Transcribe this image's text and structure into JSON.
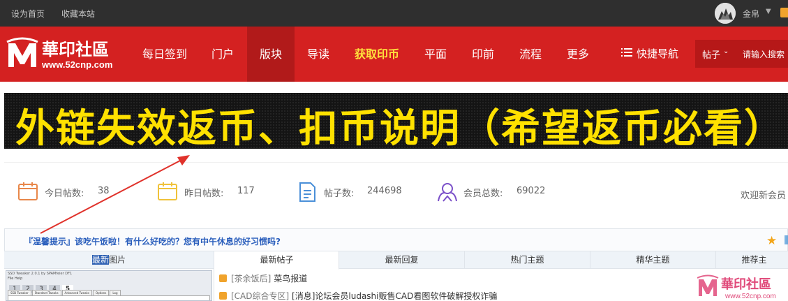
{
  "topbar": {
    "set_home": "设为首页",
    "bookmark": "收藏本站",
    "username": "金帛"
  },
  "nav": {
    "logo_cn": "華印社區",
    "logo_url": "www.52cnp.com",
    "items": [
      {
        "label": "每日签到"
      },
      {
        "label": "门户"
      },
      {
        "label": "版块"
      },
      {
        "label": "导读"
      },
      {
        "label": "获取印币"
      },
      {
        "label": "平面"
      },
      {
        "label": "印前"
      },
      {
        "label": "流程"
      },
      {
        "label": "更多"
      }
    ],
    "active_index": 2,
    "highlight_index": 4,
    "quick_nav": "快捷导航",
    "search_type": "帖子",
    "search_placeholder": "请输入搜索"
  },
  "banner": {
    "text": "外链失效返币、扣币说明（希望返币必看）"
  },
  "stats": {
    "today_label": "今日帖数:",
    "today_value": "38",
    "yesterday_label": "昨日帖数:",
    "yesterday_value": "117",
    "posts_label": "帖子数:",
    "posts_value": "244698",
    "members_label": "会员总数:",
    "members_value": "69022",
    "welcome": "欢迎新会员"
  },
  "notice": {
    "text": "『温馨提示』该吃午饭啦！有什么好吃的？您有中午休息的好习惯吗?"
  },
  "left_panel": {
    "title_sel": "最新",
    "title_rest": "图片",
    "thumb_title": "SSD Tweaker 2.0.1 by SPAMfeier DF1",
    "thumb_menu": "File   Help",
    "thumb_numbers": [
      "1",
      "2",
      "3",
      "4",
      "5"
    ],
    "thumb_tabs": [
      "SSD Tweaker",
      "Standard Tweaks",
      "Advanced Tweaks",
      "Options",
      "Log"
    ]
  },
  "tabs": [
    {
      "label": "最新帖子"
    },
    {
      "label": "最新回复"
    },
    {
      "label": "热门主题"
    },
    {
      "label": "精华主题"
    },
    {
      "label": "推荐主"
    }
  ],
  "posts": [
    {
      "category": "[茶余饭后]",
      "title": "菜鸟报道"
    },
    {
      "category": "[CAD综合专区]",
      "title": "[消息]论坛会员ludashi贩售CAD看图软件破解授权诈骗"
    }
  ],
  "watermark": {
    "text": "華印社區",
    "url": "www.52cnp.com"
  },
  "colors": {
    "nav_red": "#d42121",
    "nav_active": "#b11a1a",
    "banner_text": "#ffe100",
    "notice_blue": "#2a5ebc",
    "arrow_red": "#e0322b"
  }
}
